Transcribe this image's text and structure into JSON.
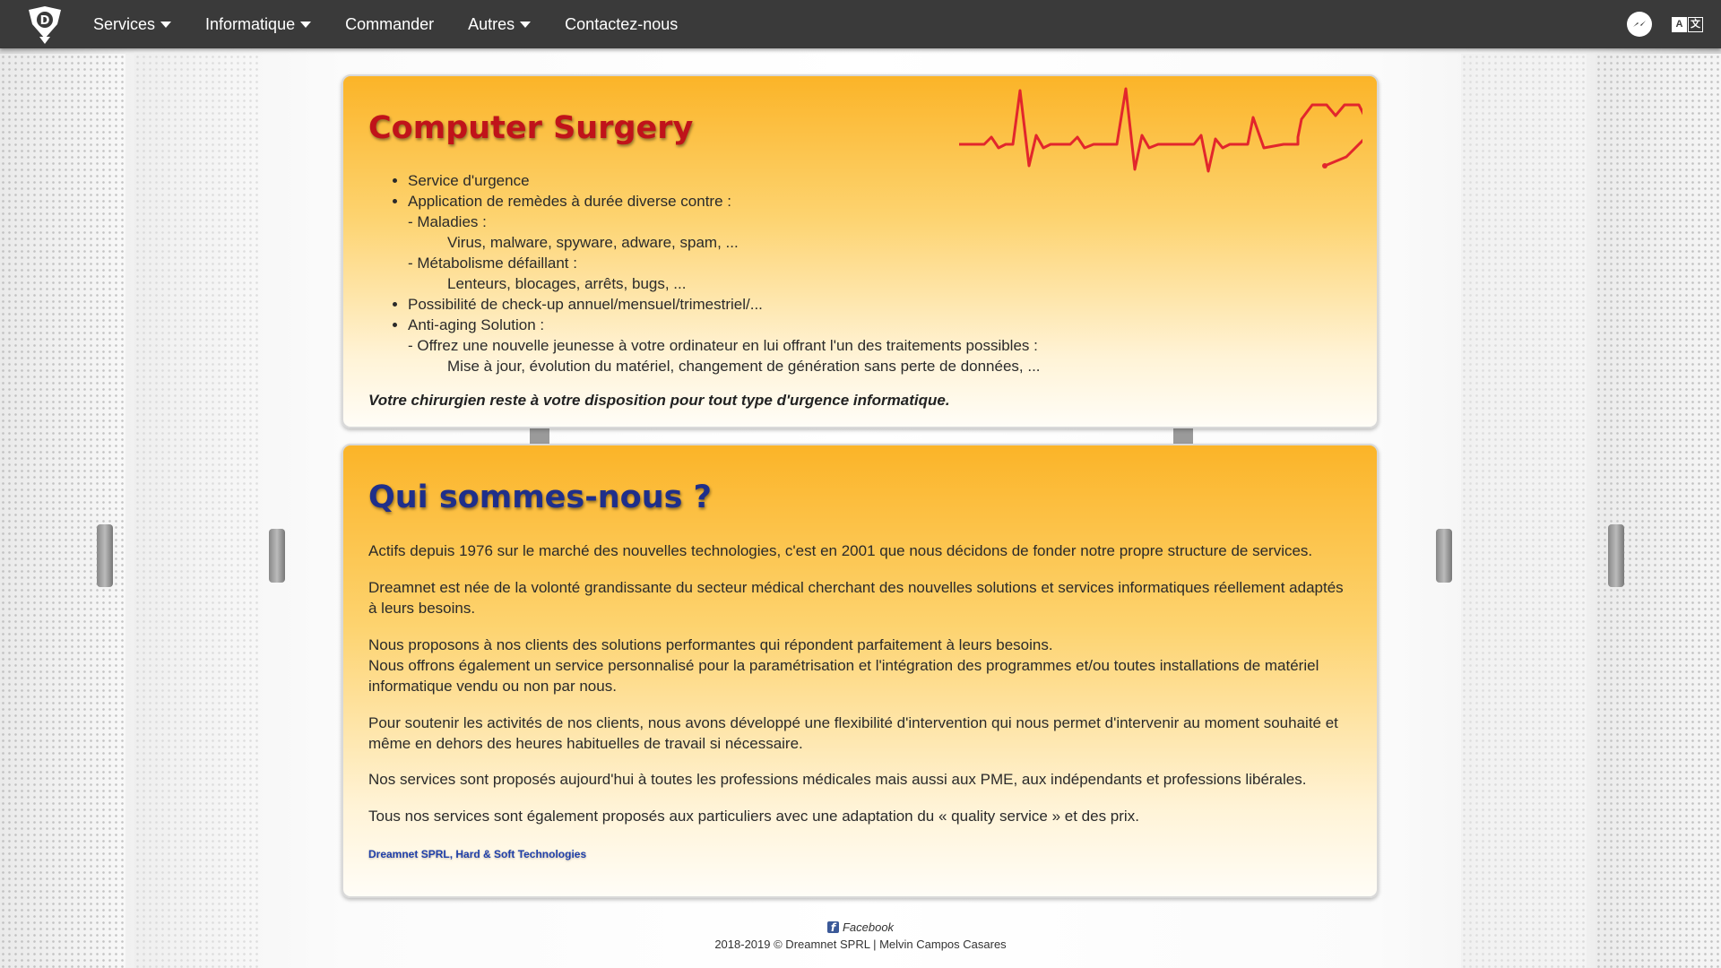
{
  "nav": {
    "items": [
      {
        "label": "Services",
        "dropdown": true
      },
      {
        "label": "Informatique",
        "dropdown": true
      },
      {
        "label": "Commander",
        "dropdown": false
      },
      {
        "label": "Autres",
        "dropdown": true
      },
      {
        "label": "Contactez-nous",
        "dropdown": false
      }
    ],
    "lang_a": "A",
    "lang_b": "文"
  },
  "surgery": {
    "title": "Computer Surgery",
    "items": [
      "Service d'urgence",
      "Application de remèdes à durée diverse contre :",
      "- Maladies :",
      "Virus, malware, spyware, adware, spam, ...",
      "- Métabolisme défaillant :",
      "Lenteurs, blocages, arrêts, bugs, ...",
      "Possibilité de check-up annuel/mensuel/trimestriel/...",
      "Anti-aging Solution :",
      "- Offrez une nouvelle jeunesse à votre ordinateur en lui offrant l'un des traitements possibles :",
      "Mise à jour, évolution du matériel, changement de génération sans perte de données, ..."
    ],
    "closing": "Votre chirurgien reste à votre disposition pour tout type d'urgence informatique."
  },
  "about": {
    "title": "Qui sommes-nous ?",
    "p1": "Actifs depuis 1976 sur le marché des nouvelles technologies, c'est en 2001 que nous décidons de fonder notre propre structure de services.",
    "p2": "Dreamnet est née de la volonté grandissante du secteur médical cherchant des nouvelles solutions et services informatiques réellement adaptés à leurs besoins.",
    "p3a": "Nous proposons à nos clients des solutions performantes qui répondent parfaitement à leurs besoins.",
    "p3b": "Nous offrons également un service personnalisé pour la paramétrisation et l'intégration des programmes et/ou toutes installations de matériel informatique vendu ou non par nous.",
    "p4": "Pour soutenir les activités de nos clients, nous avons développé une flexibilité d'intervention qui nous permet d'intervenir au moment souhaité et même en dehors des heures habituelles de travail si nécessaire.",
    "p5": "Nos services sont proposés aujourd'hui à toutes les professions médicales mais aussi aux PME, aux indépendants et professions libérales.",
    "p6": "Tous nos services sont également proposés aux particuliers avec une adaptation du « quality service » et des prix.",
    "signature": "Dreamnet SPRL, Hard & Soft Technologies"
  },
  "footer": {
    "facebook": "Facebook",
    "copyright": "2018-2019 © Dreamnet SPRL | Melvin Campos Casares"
  },
  "colors": {
    "navbar": "#3a3a3a",
    "card_top": "#fbb428",
    "surgery_title": "#c0131a",
    "about_title": "#1f2f8a",
    "heartbeat": "#e2262c"
  },
  "icons": {
    "logo": "dreamnet-shield-logo",
    "messenger": "messenger-icon",
    "language": "translate-icon",
    "heartbeat": "heartbeat-heart-icon",
    "facebook": "facebook-icon"
  }
}
